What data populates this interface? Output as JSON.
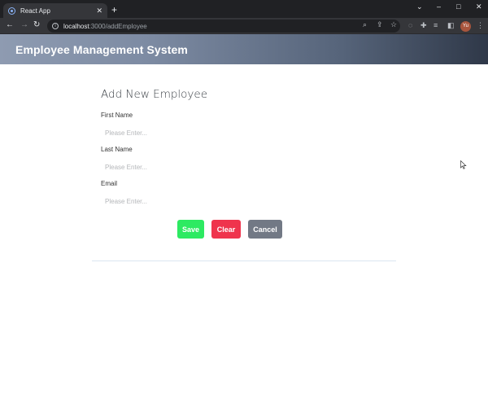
{
  "browser": {
    "tab_title": "React App",
    "tab_close": "✕",
    "new_tab": "+",
    "url_host": "localhost",
    "url_path": ":3000/addEmployee",
    "profile_initials": "Yu"
  },
  "header": {
    "title": "Employee Management System"
  },
  "form": {
    "title": "Add New Employee",
    "fields": [
      {
        "label": "First Name",
        "placeholder": "Please Enter...",
        "value": ""
      },
      {
        "label": "Last Name",
        "placeholder": "Please Enter...",
        "value": ""
      },
      {
        "label": "Email",
        "placeholder": "Please Enter...",
        "value": ""
      }
    ],
    "buttons": {
      "save": "Save",
      "clear": "Clear",
      "cancel": "Cancel"
    }
  },
  "colors": {
    "save": "#2dea62",
    "clear": "#ef344d",
    "cancel": "#727985"
  }
}
